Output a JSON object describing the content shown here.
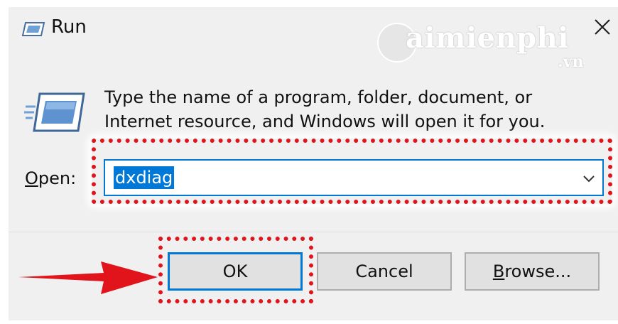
{
  "window": {
    "title": "Run",
    "icons": {
      "title": "run-icon",
      "body": "run-icon",
      "close": "close-icon",
      "dropdown": "chevron-down-icon",
      "annotation": "arrow-right-icon"
    }
  },
  "watermark": {
    "brand": "aimienphi",
    "suffix": ".vn"
  },
  "description": "Type the name of a program, folder, document, or Internet resource, and Windows will open it for you.",
  "open": {
    "label_access": "O",
    "label_rest": "pen:",
    "value": "dxdiag"
  },
  "buttons": {
    "ok": "OK",
    "cancel": "Cancel",
    "browse_access": "B",
    "browse_rest": "rowse..."
  },
  "colors": {
    "highlight": "#e0141a",
    "accent": "#0078d7",
    "dialog_bg": "#f0f0f0"
  }
}
